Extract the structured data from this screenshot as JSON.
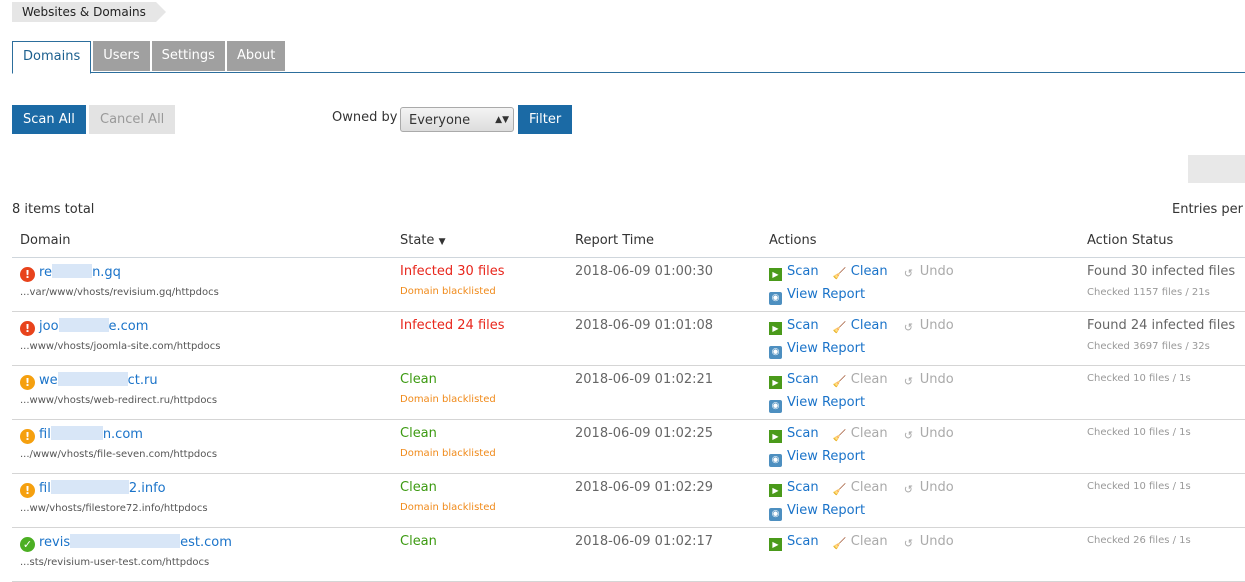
{
  "breadcrumb": "Websites & Domains",
  "tabs": [
    "Domains",
    "Users",
    "Settings",
    "About"
  ],
  "toolbar": {
    "scan_all": "Scan All",
    "cancel_all": "Cancel All",
    "owned_by_label": "Owned by",
    "owned_by_value": "Everyone",
    "filter": "Filter"
  },
  "items_total": "8 items total",
  "entries_per": "Entries per",
  "columns": {
    "domain": "Domain",
    "state": "State",
    "report_time": "Report Time",
    "actions": "Actions",
    "action_status": "Action Status"
  },
  "actions": {
    "scan": "Scan",
    "clean": "Clean",
    "undo": "Undo",
    "view_report": "View Report"
  },
  "rows": [
    {
      "status": "error",
      "name_start": "re",
      "name_end": "n.gq",
      "path": "...var/www/vhosts/revisium.gq/httpdocs",
      "state": "Infected 30 files",
      "state_type": "infected",
      "note": "Domain blacklisted",
      "time": "2018-06-09 01:00:30",
      "clean_enabled": true,
      "report": true,
      "found": "Found 30 infected files",
      "checked": "Checked 1157 files / 21s"
    },
    {
      "status": "error",
      "name_start": "joo",
      "name_end": "e.com",
      "path": "...www/vhosts/joomla-site.com/httpdocs",
      "state": "Infected 24 files",
      "state_type": "infected",
      "note": "",
      "time": "2018-06-09 01:01:08",
      "clean_enabled": true,
      "report": true,
      "found": "Found 24 infected files",
      "checked": "Checked 3697 files / 32s"
    },
    {
      "status": "warning",
      "name_start": "we",
      "name_end": "ct.ru",
      "path": "...www/vhosts/web-redirect.ru/httpdocs",
      "state": "Clean",
      "state_type": "clean",
      "note": "Domain blacklisted",
      "time": "2018-06-09 01:02:21",
      "clean_enabled": false,
      "report": true,
      "found": "",
      "checked": "Checked 10 files / 1s"
    },
    {
      "status": "warning",
      "name_start": "fil",
      "name_end": "n.com",
      "path": ".../www/vhosts/file-seven.com/httpdocs",
      "state": "Clean",
      "state_type": "clean",
      "note": "Domain blacklisted",
      "time": "2018-06-09 01:02:25",
      "clean_enabled": false,
      "report": true,
      "found": "",
      "checked": "Checked 10 files / 1s"
    },
    {
      "status": "warning",
      "name_start": "fil",
      "name_end": "2.info",
      "path": "...ww/vhosts/filestore72.info/httpdocs",
      "state": "Clean",
      "state_type": "clean",
      "note": "Domain blacklisted",
      "time": "2018-06-09 01:02:29",
      "clean_enabled": false,
      "report": true,
      "found": "",
      "checked": "Checked 10 files / 1s"
    },
    {
      "status": "ok",
      "name_start": "revis",
      "name_end": "est.com",
      "path": "...sts/revisium-user-test.com/httpdocs",
      "state": "Clean",
      "state_type": "clean",
      "note": "",
      "time": "2018-06-09 01:02:17",
      "clean_enabled": false,
      "report": false,
      "found": "",
      "checked": "Checked 26 files / 1s"
    }
  ],
  "colors": {
    "primary": "#1b6aa5",
    "infected": "#e8261c",
    "clean": "#3c9a11",
    "warning": "#f08a1a",
    "link": "#1a73c9"
  }
}
